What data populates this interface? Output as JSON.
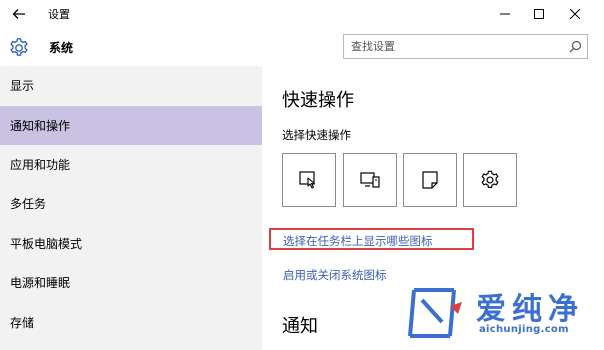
{
  "titlebar": {
    "title": "设置",
    "back_icon": "back-arrow-icon",
    "minimize_icon": "minimize-icon",
    "maximize_icon": "maximize-icon",
    "close_icon": "close-icon"
  },
  "header": {
    "icon": "gear-icon",
    "title": "系统"
  },
  "search": {
    "value": "",
    "placeholder": "查找设置",
    "icon": "search-icon"
  },
  "sidebar": {
    "items": [
      {
        "label": "显示",
        "active": false
      },
      {
        "label": "通知和操作",
        "active": true
      },
      {
        "label": "应用和功能",
        "active": false
      },
      {
        "label": "多任务",
        "active": false
      },
      {
        "label": "平板电脑模式",
        "active": false
      },
      {
        "label": "电源和睡眠",
        "active": false
      },
      {
        "label": "存储",
        "active": false
      }
    ]
  },
  "main": {
    "quick_actions_title": "快速操作",
    "quick_actions_subtitle": "选择快速操作",
    "tiles": [
      {
        "icon": "tablet-mode-icon"
      },
      {
        "icon": "connect-display-icon"
      },
      {
        "icon": "note-icon"
      },
      {
        "icon": "all-settings-icon"
      }
    ],
    "link_taskbar_icons": "选择在任务栏上显示哪些图标",
    "link_system_icons": "启用或关闭系统图标",
    "notifications_title": "通知"
  },
  "watermark": {
    "text": "爱纯净",
    "url": "aichunjing.com"
  },
  "colors": {
    "sidebar_bg": "#f2f2f2",
    "active_item_bg": "#c9c2e2",
    "link": "#3a5fb8",
    "highlight": "#d94040",
    "watermark": "#3b6fd0"
  }
}
